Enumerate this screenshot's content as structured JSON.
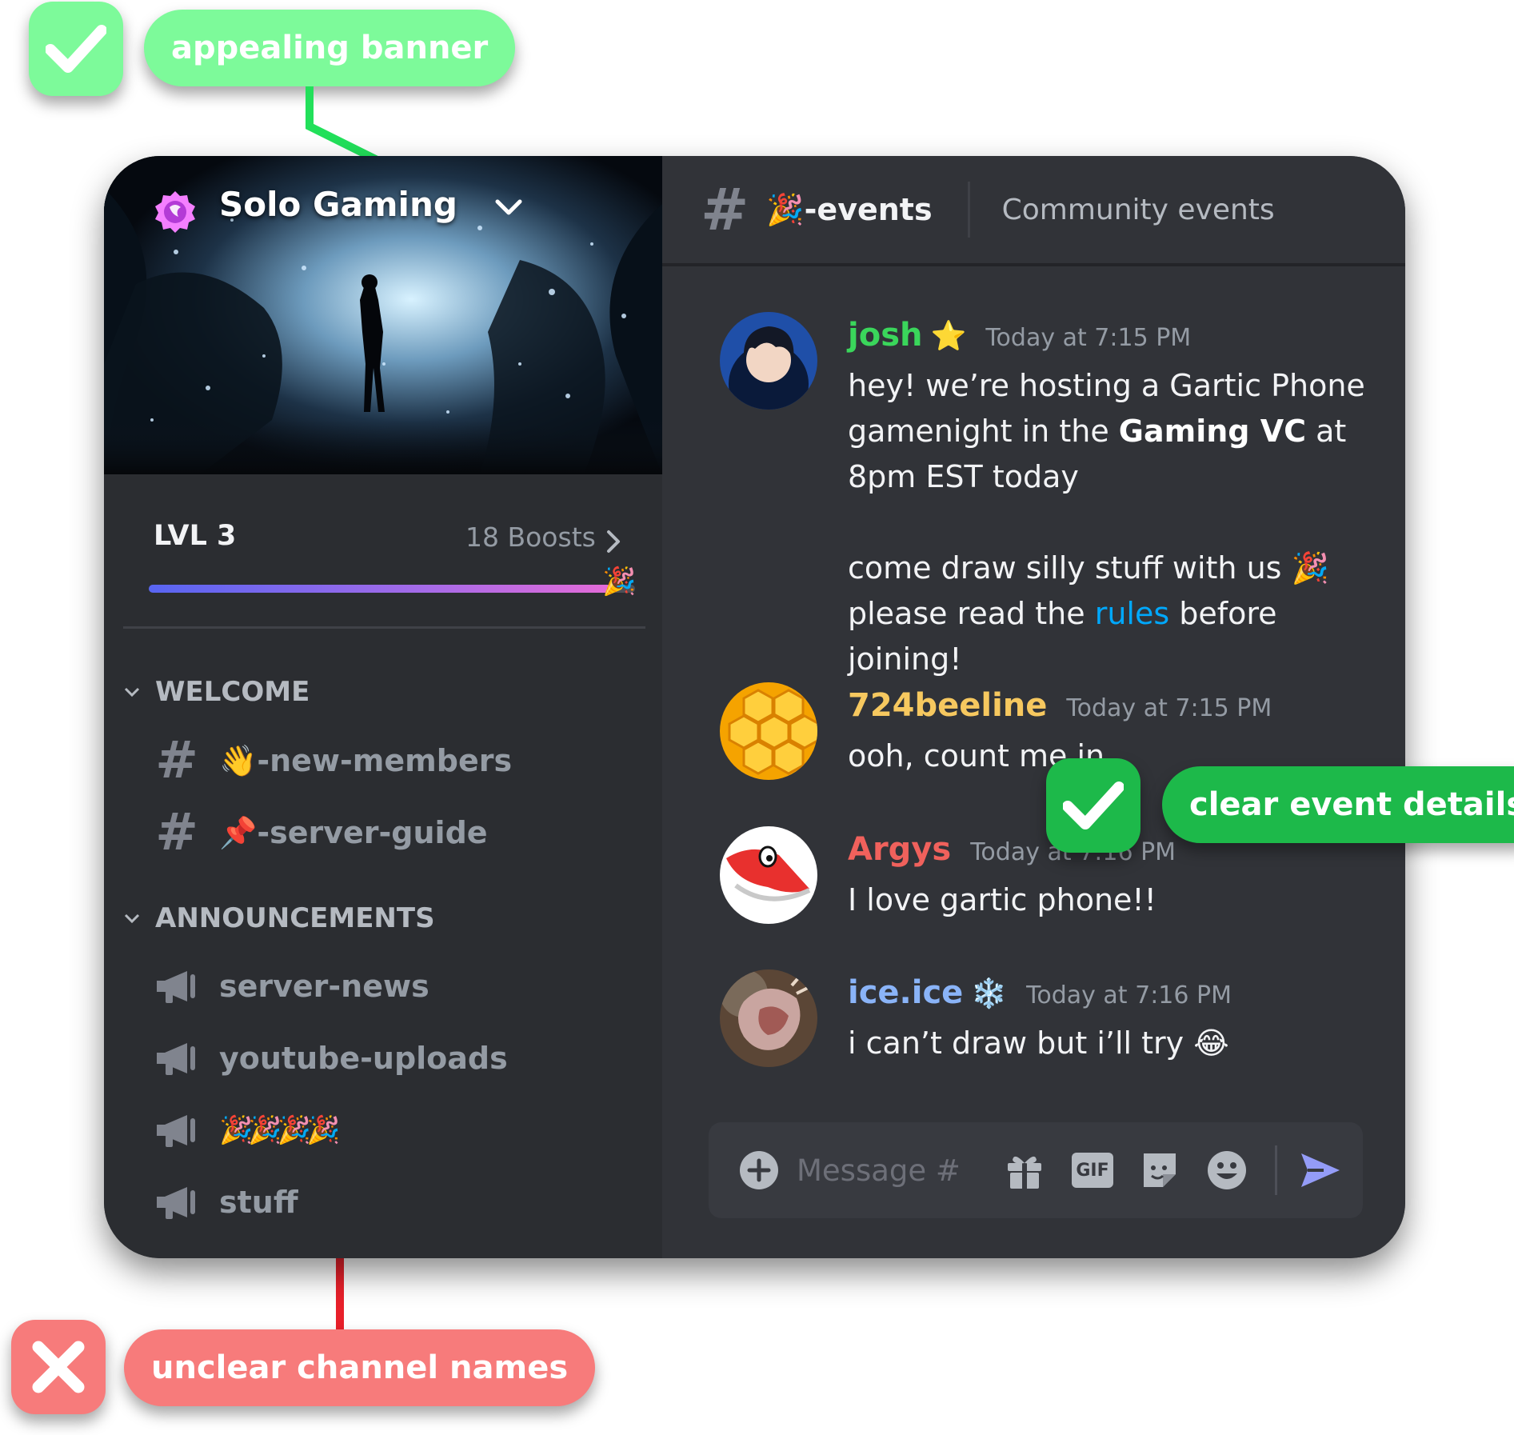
{
  "annotations": {
    "good_banner": "appealing banner",
    "good_event": "clear event details",
    "bad_channels": "unclear channel names",
    "good_color": "#7dfa9a",
    "good_event_color": "#1db94a",
    "bad_color": "#f77b7b",
    "connector_good_color": "#22e05a",
    "connector_bad_color": "#e8202a"
  },
  "server": {
    "name": "Solo Gaming",
    "level": "LVL 3",
    "boosts": "18 Boosts",
    "boost_progress": 0.95
  },
  "categories": [
    {
      "label": "WELCOME",
      "channels": [
        {
          "icon": "hash-icon",
          "emoji": "👋",
          "name": "-new-members"
        },
        {
          "icon": "hash-icon",
          "emoji": "📌",
          "name": "-server-guide"
        }
      ]
    },
    {
      "label": "ANNOUNCEMENTS",
      "channels": [
        {
          "icon": "megaphone-icon",
          "emoji": "",
          "name": "server-news"
        },
        {
          "icon": "megaphone-icon",
          "emoji": "",
          "name": "youtube-uploads"
        },
        {
          "icon": "megaphone-icon",
          "emoji": "🎉🎉🎉🎉",
          "name": ""
        },
        {
          "icon": "megaphone-icon",
          "emoji": "",
          "name": "stuff"
        }
      ]
    }
  ],
  "channel_header": {
    "emoji": "🎉",
    "name": "-events",
    "topic": "Community events"
  },
  "messages": [
    {
      "author": "josh",
      "author_color": "#3ad65b",
      "badge": "⭐",
      "time": "Today at 7:15 PM",
      "line1": "hey! we’re hosting a Gartic Phone gamenight in the ",
      "bold": "Gaming VC",
      "line1_end": " at 8pm EST today",
      "line2": "come draw silly stuff with us 🎉",
      "line3_start": "please read the ",
      "link": "rules",
      "line3_end": " before joining!"
    },
    {
      "author": "724beeline",
      "author_color": "#f6c85f",
      "badge": "",
      "time": "Today at 7:15 PM",
      "text": "ooh, count me in"
    },
    {
      "author": "Argys",
      "author_color": "#f0615c",
      "badge": "",
      "time": "Today at 7:16 PM",
      "text": "I love gartic phone!!"
    },
    {
      "author": "ice.ice",
      "author_color": "#8ab4f8",
      "badge": "❄️",
      "time": "Today at 7:16 PM",
      "text": "i can’t draw but i’ll try 😂"
    }
  ],
  "composer": {
    "placeholder": "Message #",
    "gif_label": "GIF"
  }
}
